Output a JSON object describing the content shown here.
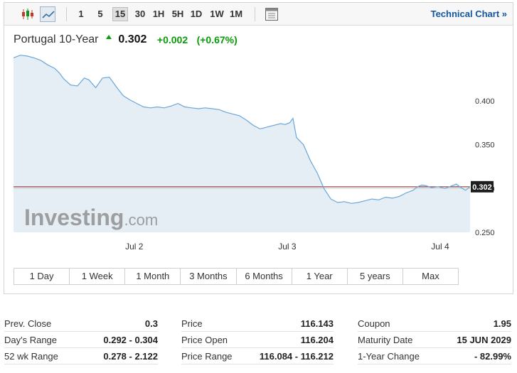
{
  "toolbar": {
    "icons": [
      "candlestick-icon",
      "line-chart-icon",
      "calendar-icon"
    ],
    "timeframes": [
      "1",
      "5",
      "15",
      "30",
      "1H",
      "5H",
      "1D",
      "1W",
      "1M"
    ],
    "active_timeframe": "15",
    "technical_link": "Technical Chart »"
  },
  "instrument": {
    "name": "Portugal 10-Year",
    "last": "0.302",
    "change": "+0.002",
    "change_pct": "(+0.67%)",
    "up_color": "#0a9b0a"
  },
  "watermark": {
    "main": "Investing",
    "suffix": ".com"
  },
  "chart_data": {
    "type": "area",
    "x_ticks": [
      {
        "x": 0.265,
        "label": "Jul 2"
      },
      {
        "x": 0.6,
        "label": "Jul 3"
      },
      {
        "x": 0.935,
        "label": "Jul 4"
      }
    ],
    "xlim": [
      0,
      1
    ],
    "ylim": [
      0.25,
      0.455
    ],
    "y_ticks": [
      0.25,
      0.3,
      0.35,
      0.4
    ],
    "y_tick_labels": [
      "0.250",
      "0.300",
      "0.350",
      "0.400"
    ],
    "last_value_label": "0.302",
    "reference_value": 0.302,
    "line_color": "#6aa6d8",
    "fill_color": "#e6eef5",
    "reference_line_color": "#8b2a2a",
    "series": [
      {
        "values": [
          [
            0.0,
            0.449
          ],
          [
            0.015,
            0.452
          ],
          [
            0.03,
            0.451
          ],
          [
            0.045,
            0.449
          ],
          [
            0.06,
            0.446
          ],
          [
            0.075,
            0.441
          ],
          [
            0.09,
            0.437
          ],
          [
            0.1,
            0.432
          ],
          [
            0.11,
            0.425
          ],
          [
            0.125,
            0.418
          ],
          [
            0.14,
            0.417
          ],
          [
            0.155,
            0.426
          ],
          [
            0.165,
            0.424
          ],
          [
            0.18,
            0.415
          ],
          [
            0.195,
            0.426
          ],
          [
            0.21,
            0.427
          ],
          [
            0.225,
            0.416
          ],
          [
            0.24,
            0.406
          ],
          [
            0.255,
            0.401
          ],
          [
            0.27,
            0.397
          ],
          [
            0.285,
            0.393
          ],
          [
            0.3,
            0.392
          ],
          [
            0.315,
            0.393
          ],
          [
            0.33,
            0.392
          ],
          [
            0.345,
            0.394
          ],
          [
            0.36,
            0.397
          ],
          [
            0.375,
            0.393
          ],
          [
            0.39,
            0.392
          ],
          [
            0.405,
            0.391
          ],
          [
            0.42,
            0.392
          ],
          [
            0.435,
            0.391
          ],
          [
            0.45,
            0.39
          ],
          [
            0.465,
            0.387
          ],
          [
            0.48,
            0.385
          ],
          [
            0.495,
            0.383
          ],
          [
            0.51,
            0.378
          ],
          [
            0.525,
            0.372
          ],
          [
            0.54,
            0.368
          ],
          [
            0.555,
            0.37
          ],
          [
            0.57,
            0.372
          ],
          [
            0.585,
            0.374
          ],
          [
            0.595,
            0.373
          ],
          [
            0.605,
            0.375
          ],
          [
            0.612,
            0.38
          ],
          [
            0.62,
            0.358
          ],
          [
            0.635,
            0.35
          ],
          [
            0.65,
            0.332
          ],
          [
            0.665,
            0.318
          ],
          [
            0.68,
            0.3
          ],
          [
            0.695,
            0.288
          ],
          [
            0.71,
            0.284
          ],
          [
            0.725,
            0.285
          ],
          [
            0.74,
            0.283
          ],
          [
            0.755,
            0.284
          ],
          [
            0.77,
            0.286
          ],
          [
            0.785,
            0.288
          ],
          [
            0.8,
            0.287
          ],
          [
            0.815,
            0.29
          ],
          [
            0.83,
            0.289
          ],
          [
            0.845,
            0.291
          ],
          [
            0.86,
            0.295
          ],
          [
            0.875,
            0.298
          ],
          [
            0.885,
            0.302
          ],
          [
            0.895,
            0.304
          ],
          [
            0.905,
            0.303
          ],
          [
            0.915,
            0.301
          ],
          [
            0.93,
            0.302
          ],
          [
            0.945,
            0.3
          ],
          [
            0.96,
            0.303
          ],
          [
            0.97,
            0.305
          ],
          [
            0.98,
            0.301
          ],
          [
            0.99,
            0.298
          ],
          [
            1.0,
            0.302
          ]
        ]
      }
    ]
  },
  "ranges": [
    "1 Day",
    "1 Week",
    "1 Month",
    "3 Months",
    "6 Months",
    "1 Year",
    "5 years",
    "Max"
  ],
  "stats": {
    "col1": [
      {
        "label": "Prev. Close",
        "value": "0.3"
      },
      {
        "label": "Day's Range",
        "value": "0.292 - 0.304"
      },
      {
        "label": "52 wk Range",
        "value": "0.278 - 2.122"
      }
    ],
    "col2": [
      {
        "label": "Price",
        "value": "116.143"
      },
      {
        "label": "Price Open",
        "value": "116.204"
      },
      {
        "label": "Price Range",
        "value": "116.084 - 116.212"
      }
    ],
    "col3": [
      {
        "label": "Coupon",
        "value": "1.95"
      },
      {
        "label": "Maturity Date",
        "value": "15 JUN 2029"
      },
      {
        "label": "1-Year Change",
        "value": "- 82.99%"
      }
    ]
  }
}
